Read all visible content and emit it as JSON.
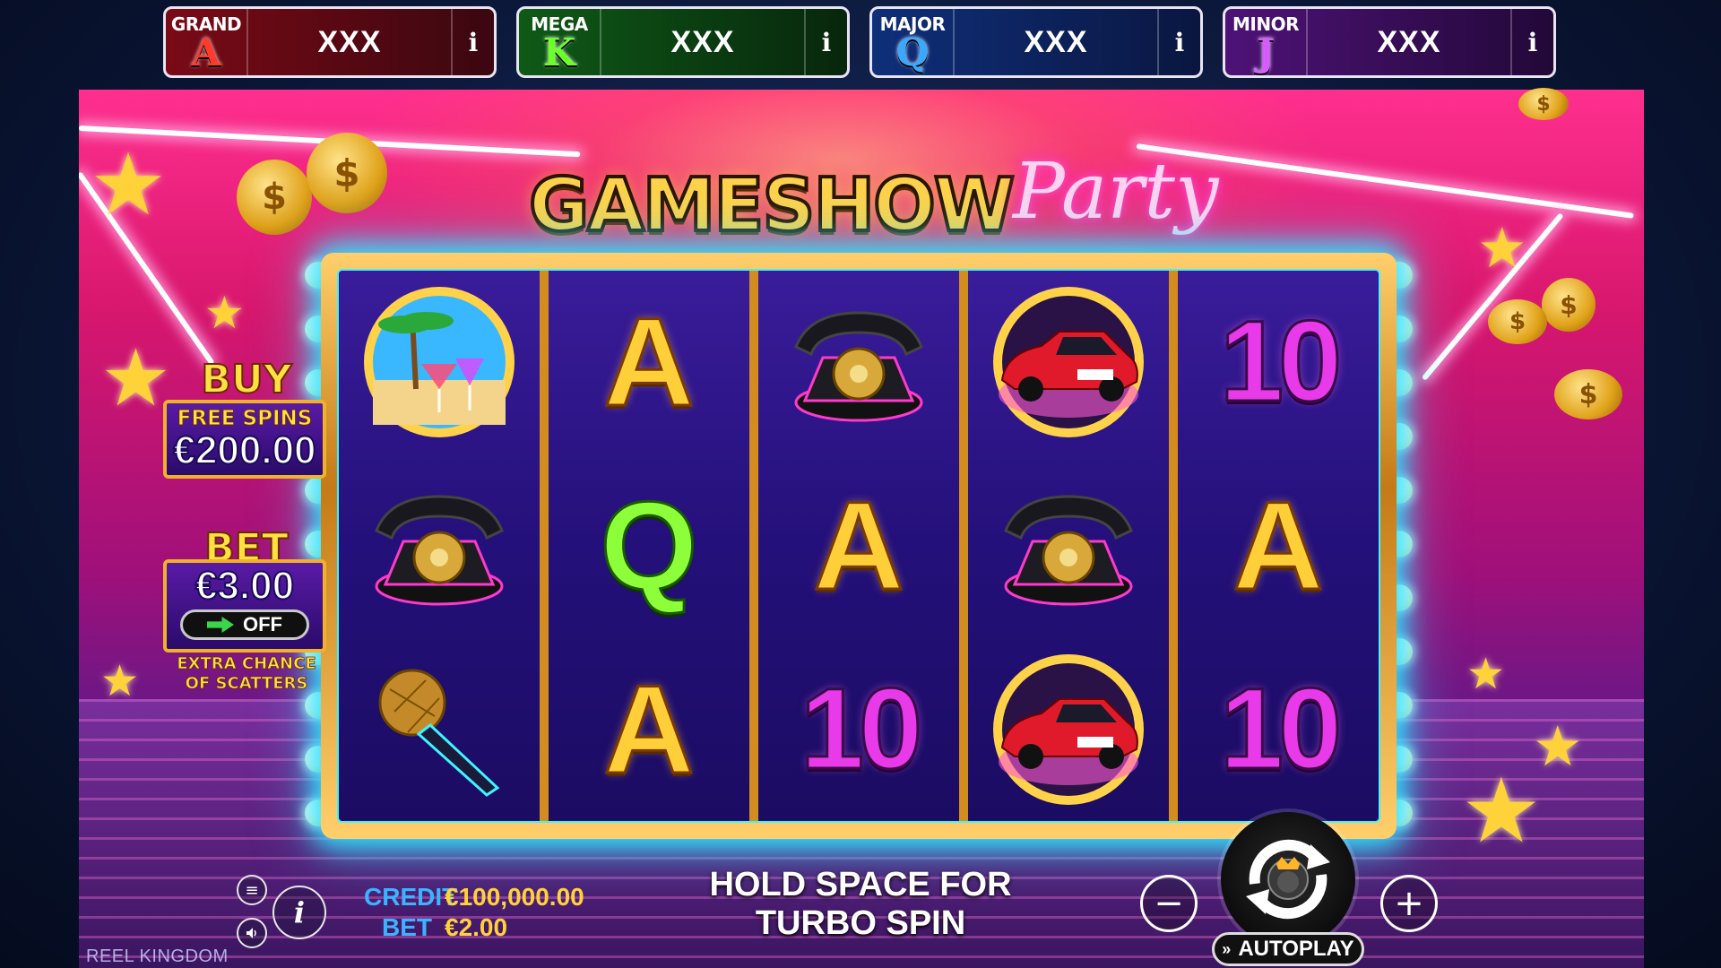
{
  "jackpots": [
    {
      "name": "GRAND",
      "letter": "A",
      "letter_color": "#ff3a2a",
      "value": "XXX",
      "info": "i"
    },
    {
      "name": "MEGA",
      "letter": "K",
      "letter_color": "#6cff2a",
      "value": "XXX",
      "info": "i"
    },
    {
      "name": "MAJOR",
      "letter": "Q",
      "letter_color": "#3aa8ff",
      "value": "XXX",
      "info": "i"
    },
    {
      "name": "MINOR",
      "letter": "J",
      "letter_color": "#d85bff",
      "value": "XXX",
      "info": "i"
    }
  ],
  "logo": {
    "word1": "GAMESHOW",
    "word2": "Party"
  },
  "reels": [
    [
      "cocktail-beach",
      "telephone",
      "microphone"
    ],
    [
      "A",
      "Q",
      "A"
    ],
    [
      "telephone",
      "A",
      "10"
    ],
    [
      "sports-car",
      "telephone",
      "sports-car"
    ],
    [
      "10",
      "A",
      "10"
    ]
  ],
  "car_plate": "REEL KDM",
  "buy_panel": {
    "title": "BUY",
    "subtitle": "FREE SPINS",
    "price": "€200.00"
  },
  "bet_panel": {
    "title": "BET",
    "amount": "€3.00",
    "toggle": "OFF",
    "caption_line1": "EXTRA CHANCE",
    "caption_line2": "OF SCATTERS"
  },
  "hud": {
    "credit_label": "CREDIT",
    "credit_value": "€100,000.00",
    "bet_label": "BET",
    "bet_value": "€2.00",
    "turbo_hint": "HOLD SPACE FOR TURBO SPIN",
    "minus": "−",
    "plus": "+",
    "autoplay": "AUTOPLAY",
    "info": "i"
  },
  "brand": "REEL KINGDOM",
  "icons": [
    "menu-icon",
    "info-icon",
    "sound-icon",
    "spin-arrows-icon",
    "autoplay-icon"
  ],
  "colors": {
    "cyan_glow": "#31e3ff",
    "gold": "#ffd23a",
    "credit_label": "#3ab4ff"
  }
}
